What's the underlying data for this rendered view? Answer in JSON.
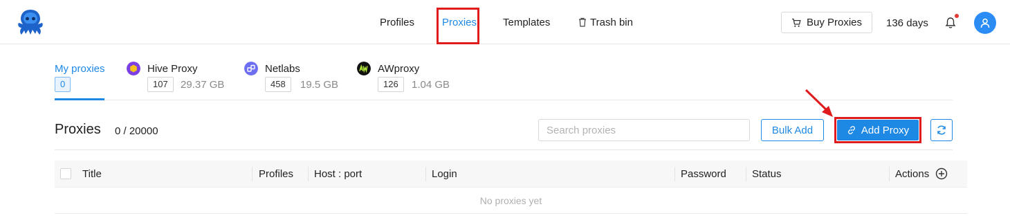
{
  "nav": {
    "items": [
      {
        "label": "Profiles"
      },
      {
        "label": "Proxies"
      },
      {
        "label": "Templates"
      },
      {
        "label": "Trash bin"
      }
    ],
    "buy_label": "Buy Proxies",
    "days_left": "136 days"
  },
  "providers": [
    {
      "title": "My proxies",
      "count": "0"
    },
    {
      "title": "Hive Proxy",
      "count": "107",
      "size": "29.37 GB"
    },
    {
      "title": "Netlabs",
      "count": "458",
      "size": "19.5 GB"
    },
    {
      "title": "AWproxy",
      "count": "126",
      "size": "1.04 GB"
    }
  ],
  "toolbar": {
    "title": "Proxies",
    "count": "0 / 20000",
    "search_placeholder": "Search proxies",
    "bulk_add_label": "Bulk Add",
    "add_proxy_label": "Add Proxy"
  },
  "table": {
    "columns": [
      "Title",
      "Profiles",
      "Host : port",
      "Login",
      "Password",
      "Status",
      "Actions"
    ],
    "empty_text": "No proxies yet"
  },
  "colors": {
    "accent": "#1e88e5",
    "highlight": "#e01b1b",
    "hive": "#7b3fe4",
    "netlabs": "#6d6ff0",
    "awproxy": "#111111"
  }
}
